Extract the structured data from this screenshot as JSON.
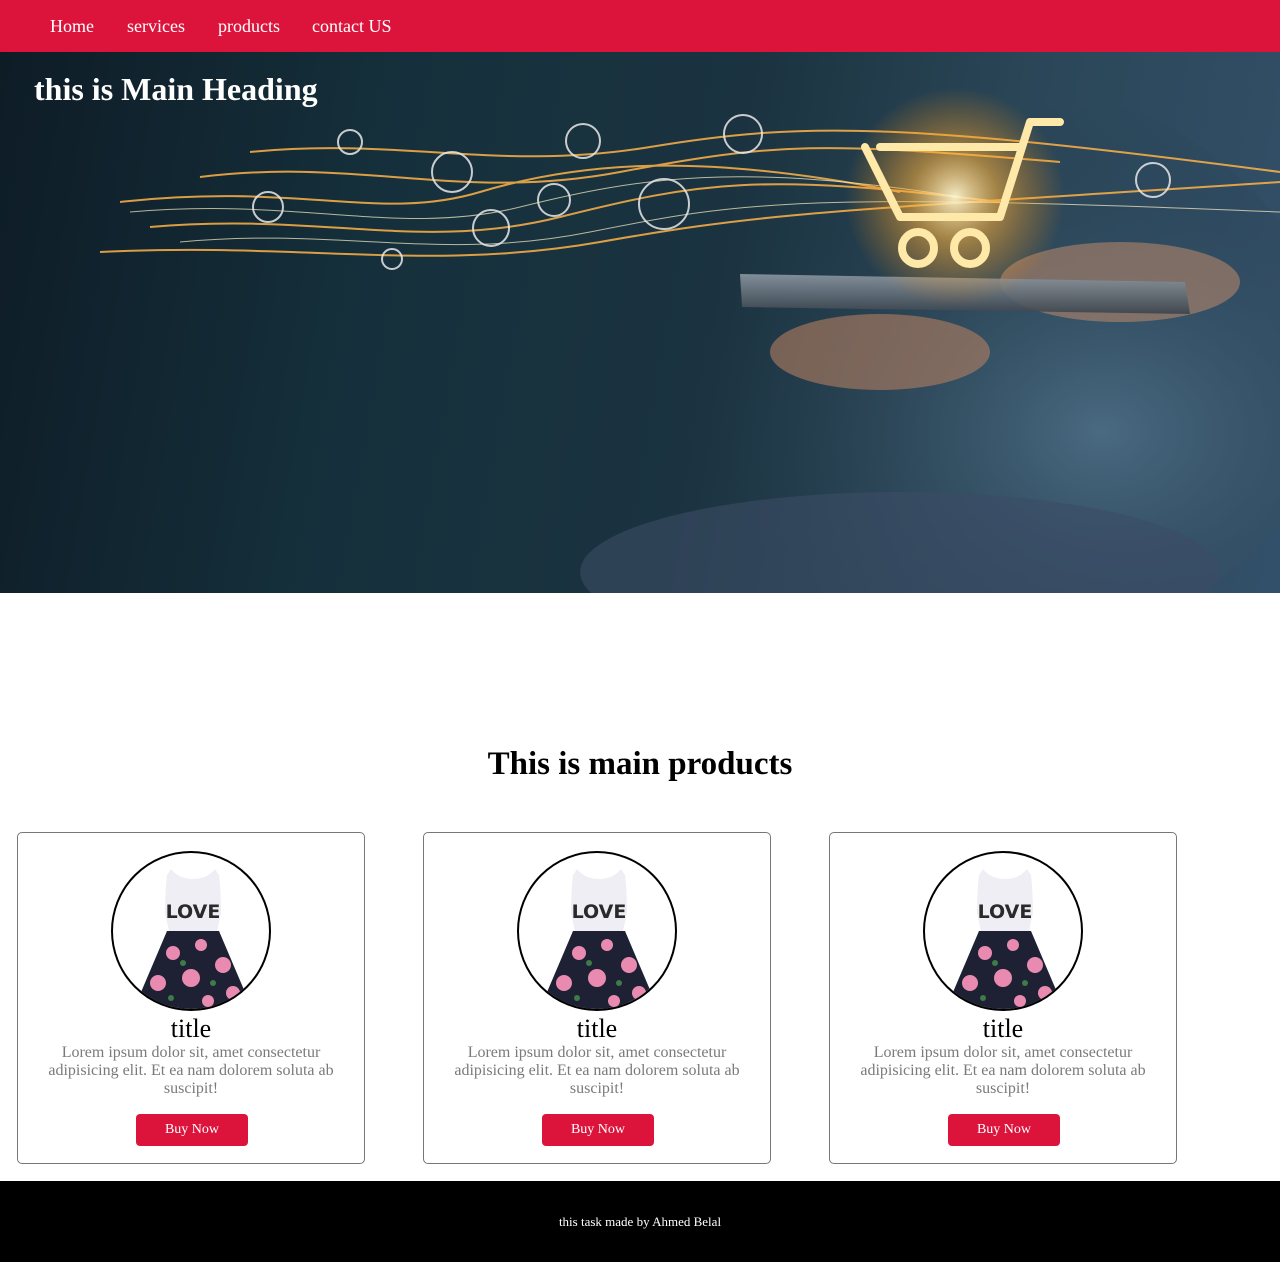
{
  "nav": {
    "items": [
      {
        "label": "Home"
      },
      {
        "label": "services"
      },
      {
        "label": "products"
      },
      {
        "label": "contact US"
      }
    ],
    "background_color": "#dc143c"
  },
  "hero": {
    "heading": "this is Main Heading",
    "image_icon": "shopping-cart-on-tablet-illustration"
  },
  "products": {
    "heading": "This is main products",
    "cards": [
      {
        "title": "title",
        "description": "Lorem ipsum dolor sit, amet consectetur adipisicing elit. Et ea nam dolorem soluta ab suscipit!",
        "button": "Buy Now",
        "image_icon": "love-dress-product-image"
      },
      {
        "title": "title",
        "description": "Lorem ipsum dolor sit, amet consectetur adipisicing elit. Et ea nam dolorem soluta ab suscipit!",
        "button": "Buy Now",
        "image_icon": "love-dress-product-image"
      },
      {
        "title": "title",
        "description": "Lorem ipsum dolor sit, amet consectetur adipisicing elit. Et ea nam dolorem soluta ab suscipit!",
        "button": "Buy Now",
        "image_icon": "love-dress-product-image"
      }
    ],
    "accent_color": "#dc143c"
  },
  "footer": {
    "text": "this task made by Ahmed Belal"
  }
}
